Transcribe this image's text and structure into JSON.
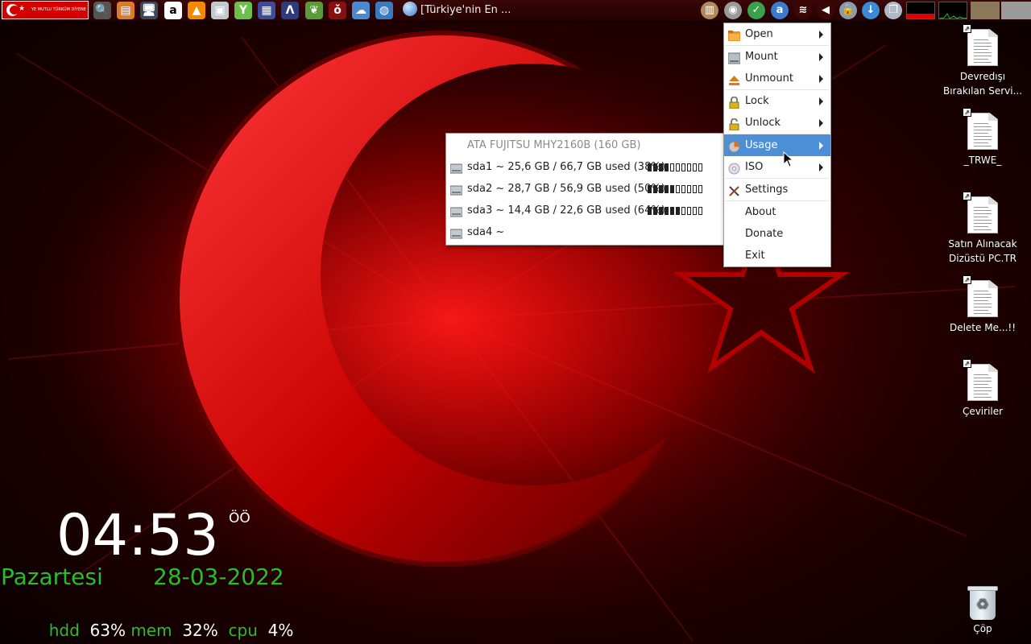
{
  "taskbar": {
    "flag_text": "YE MUTLU TÜRKÜM DİYENE",
    "launchers": [
      {
        "icon": "search-icon",
        "bg": "#555555",
        "glyph": "🔍"
      },
      {
        "icon": "archive-icon",
        "bg": "#e07a2a",
        "glyph": "▤"
      },
      {
        "icon": "monitor-icon",
        "bg": "#3a4a5a",
        "glyph": "🖥"
      },
      {
        "icon": "amazon-icon",
        "bg": "#ffffff",
        "glyph": "a"
      },
      {
        "icon": "vlc-icon",
        "bg": "#f28a00",
        "glyph": "▲"
      },
      {
        "icon": "image-viewer-icon",
        "bg": "#c0c8d0",
        "glyph": "▣"
      },
      {
        "icon": "y-app-icon",
        "bg": "#6cc04a",
        "glyph": "Y"
      },
      {
        "icon": "calculator-icon",
        "bg": "#3c4c9c",
        "glyph": "▦"
      },
      {
        "icon": "arch-icon",
        "bg": "#2c3c7c",
        "glyph": "Λ"
      },
      {
        "icon": "leaf-icon",
        "bg": "#5a9a3a",
        "glyph": "❦"
      },
      {
        "icon": "cherry-icon",
        "bg": "#8a1010",
        "glyph": "ǒ"
      },
      {
        "icon": "cloud-icon",
        "bg": "#4c88d0",
        "glyph": "☁"
      },
      {
        "icon": "globe-icon",
        "bg": "#3a7ac0",
        "glyph": "◍"
      }
    ],
    "window_title": "[Türkiye'nin En ...",
    "tray": [
      {
        "icon": "clipboard-icon",
        "bg": "#b08a5a",
        "glyph": "▥"
      },
      {
        "icon": "disk-usage-icon",
        "bg": "#9a9a9a",
        "glyph": "◉"
      },
      {
        "icon": "shield-icon",
        "bg": "#3aa04a",
        "glyph": "✓"
      },
      {
        "icon": "a-app-icon",
        "bg": "#3a7ad0",
        "glyph": "a"
      },
      {
        "icon": "wifi-icon",
        "bg": "#3a0606",
        "glyph": "≋"
      },
      {
        "icon": "volume-icon",
        "bg": "#3a0606",
        "glyph": "◀"
      },
      {
        "icon": "lock-icon",
        "bg": "#8a9ab0",
        "glyph": "🔒"
      },
      {
        "icon": "download-icon",
        "bg": "#3a8ad8",
        "glyph": "↓"
      },
      {
        "icon": "windows-icon",
        "bg": "#b0b8c8",
        "glyph": "❐"
      }
    ]
  },
  "desktop_icons": [
    {
      "label": "Devredışı Bırakılan Servi..."
    },
    {
      "label": "_TRWE_"
    },
    {
      "label": "Satın Alınacak Dizüstü PC.TR"
    },
    {
      "label": "Delete Me...!!"
    },
    {
      "label": "Çeviriler"
    }
  ],
  "trash": {
    "label": "Çöp"
  },
  "clock": {
    "time": "04:53",
    "ampm": "ÖÖ",
    "day": "Pazartesi",
    "date": "28-03-2022",
    "stats": [
      {
        "key": "hdd",
        "value": "63%"
      },
      {
        "key": "mem",
        "value": "32%"
      },
      {
        "key": "cpu",
        "value": "4%"
      }
    ]
  },
  "main_menu": {
    "items": [
      {
        "label": "Open",
        "icon": "folder-icon",
        "submenu": true
      },
      {
        "label": "Mount",
        "icon": "drive-icon",
        "submenu": true
      },
      {
        "label": "Unmount",
        "icon": "eject-icon",
        "submenu": true
      },
      {
        "label": "Lock",
        "icon": "lock-icon",
        "submenu": true
      },
      {
        "label": "Unlock",
        "icon": "unlock-icon",
        "submenu": true
      },
      {
        "label": "Usage",
        "icon": "usage-icon",
        "submenu": true,
        "highlighted": true
      },
      {
        "label": "ISO",
        "icon": "disc-icon",
        "submenu": true
      },
      {
        "label": "Settings",
        "icon": "tools-icon",
        "submenu": false
      },
      {
        "label": "About",
        "icon": "",
        "submenu": false
      },
      {
        "label": "Donate",
        "icon": "",
        "submenu": false
      },
      {
        "label": "Exit",
        "icon": "",
        "submenu": false
      }
    ]
  },
  "usage_menu": {
    "header": "ATA FUJITSU MHY2160B (160 GB)",
    "partitions": [
      {
        "label": "sda1 ~ 25,6 GB / 66,7 GB used (38%)",
        "percent": 38
      },
      {
        "label": "sda2 ~ 28,7 GB / 56,9 GB used (50%)",
        "percent": 50
      },
      {
        "label": "sda3 ~ 14,4 GB / 22,6 GB used (64%)",
        "percent": 64
      },
      {
        "label": "sda4 ~",
        "percent": null
      }
    ]
  },
  "colors": {
    "green": "#2bbb2b",
    "highlight": "#4d8fd6",
    "flag_red": "#d40000"
  }
}
